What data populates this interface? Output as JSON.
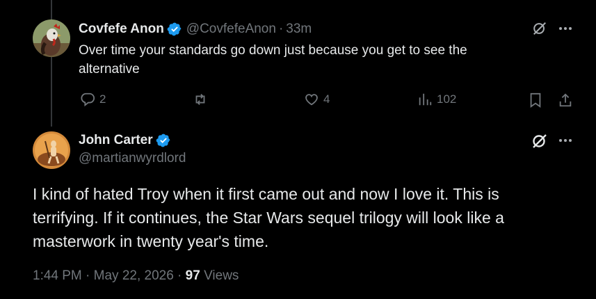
{
  "reply_tweet": {
    "display_name": "Covfefe Anon",
    "handle": "@CovfefeAnon",
    "separator": "·",
    "time_ago": "33m",
    "text": "Over time your standards go down just because you get to see the alternative",
    "replies": "2",
    "likes": "4",
    "views": "102"
  },
  "main_tweet": {
    "display_name": "John Carter",
    "handle": "@martianwyrdlord",
    "text": "I kind of hated Troy when it first came out and now I love it. This is terrifying. If it continues, the Star Wars sequel trilogy will look like a masterwork in twenty year's time.",
    "timestamp": "1:44 PM · May 22, 2026 · ",
    "view_count": "97",
    "views_label": " Views"
  },
  "colors": {
    "background": "#000000",
    "text": "#e7e9ea",
    "muted": "#71767b",
    "verified": "#1d9bf0",
    "thread_line": "#333639"
  }
}
